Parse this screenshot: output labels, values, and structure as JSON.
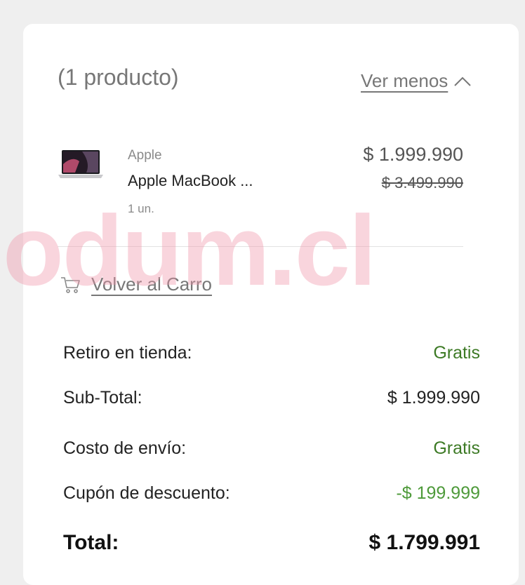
{
  "summary": {
    "count_label": "(1 producto)",
    "toggle_label": "Ver menos"
  },
  "product": {
    "brand": "Apple",
    "name": "Apple MacBook ...",
    "quantity": "1 un.",
    "price": "$ 1.999.990",
    "original_price": "$ 3.499.990"
  },
  "watermark": "odum.cl",
  "back_link": "Volver al Carro",
  "totals": [
    {
      "label": "Retiro en tienda:",
      "value": "Gratis"
    },
    {
      "label": "Sub-Total:",
      "value": "$ 1.999.990"
    },
    {
      "label": "Costo de envío:",
      "value": "Gratis"
    },
    {
      "label": "Cupón de descuento:",
      "value": "-$ 199.999"
    },
    {
      "label": "Total:",
      "value": "$ 1.799.991"
    }
  ],
  "colors": {
    "free_green": "#3d7a25",
    "discount_green": "#4e9a3a",
    "watermark_pink": "#f096aa"
  },
  "icons": [
    "chevron-up-icon",
    "cart-icon",
    "laptop-thumbnail"
  ]
}
